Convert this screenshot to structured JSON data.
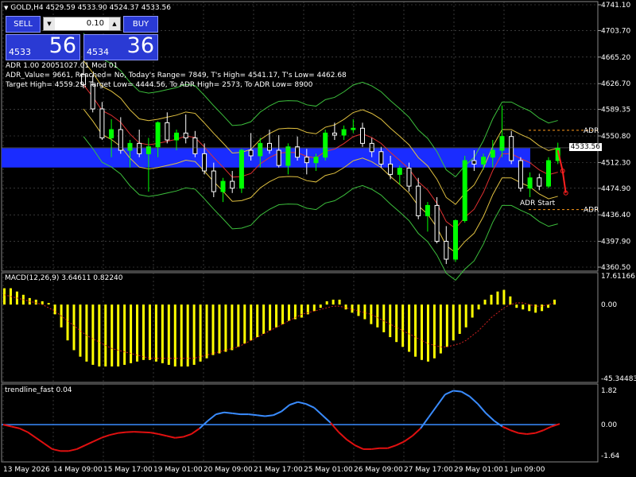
{
  "header": {
    "symbol_title": "GOLD,H4",
    "ohlc": "4529.59 4533.90 4524.37 4533.56"
  },
  "trade_panel": {
    "sell_label": "SELL",
    "buy_label": "BUY",
    "lot": "0.10",
    "sell_small": "4533",
    "sell_big": "56",
    "buy_small": "4534",
    "buy_big": "36",
    "lot_down_icon": "triangle-down",
    "lot_up_icon": "triangle-up"
  },
  "adr_info": {
    "line1": "ADR 1.00 20051027.01 Mod 01",
    "line2": "ADR_Value= 9661, Reached= No, Today's Range= 7849, T's High= 4541.17, T's Low= 4462.68",
    "line3": "Target High= 4559.29, Target Low= 4444.56, To ADR High= 2573, To ADR Low= 8900"
  },
  "price_scale": {
    "ticks": [
      "4741.10",
      "4703.70",
      "4665.20",
      "4626.70",
      "4589.35",
      "4550.80",
      "4512.30",
      "4474.90",
      "4436.40",
      "4397.90",
      "4360.50"
    ],
    "current_price": "4533.56"
  },
  "markers": {
    "adr_high": "ADR",
    "adr_low": "ADR",
    "adr_start": "ADR Start"
  },
  "macd": {
    "label": "MACD(12,26,9) 3.64611 0.82240",
    "scale_top": "17.61166",
    "scale_zero": "0.00",
    "scale_bottom": "-45.34483"
  },
  "trendline": {
    "label": "trendline_fast 0.04",
    "scale_top": "1.82",
    "scale_zero": "0.00",
    "scale_bottom": "-1.64"
  },
  "time_axis": {
    "labels": [
      "13 May 2026",
      "14 May 09:00",
      "15 May 17:00",
      "19 May 01:00",
      "20 May 09:00",
      "21 May 17:00",
      "25 May 01:00",
      "26 May 09:00",
      "27 May 17:00",
      "29 May 01:00",
      "1 Jun 09:00"
    ]
  },
  "colors": {
    "background": "#000000",
    "bull": "#00ff00",
    "bear": "#ffffff",
    "blue_band": "#1a2cff",
    "macd_hist": "#ffff00",
    "macd_signal": "#d02020",
    "trend_up": "#3a8cff",
    "trend_down": "#e01010",
    "adr_label": "#ff9a1a",
    "bollinger_outer": "#3cbf3c",
    "bollinger_inner": "#e0c040",
    "ma": "#e03030"
  },
  "chart_data": {
    "type": "candlestick",
    "price_range": [
      4360.5,
      4741.1
    ],
    "candles": [
      {
        "o": 4640,
        "h": 4660,
        "l": 4620,
        "c": 4625
      },
      {
        "o": 4625,
        "h": 4640,
        "l": 4585,
        "c": 4590
      },
      {
        "o": 4590,
        "h": 4600,
        "l": 4545,
        "c": 4548
      },
      {
        "o": 4548,
        "h": 4575,
        "l": 4520,
        "c": 4560
      },
      {
        "o": 4560,
        "h": 4578,
        "l": 4525,
        "c": 4530
      },
      {
        "o": 4530,
        "h": 4545,
        "l": 4505,
        "c": 4540
      },
      {
        "o": 4540,
        "h": 4560,
        "l": 4520,
        "c": 4525
      },
      {
        "o": 4525,
        "h": 4548,
        "l": 4470,
        "c": 4535
      },
      {
        "o": 4535,
        "h": 4572,
        "l": 4520,
        "c": 4570
      },
      {
        "o": 4570,
        "h": 4585,
        "l": 4540,
        "c": 4545
      },
      {
        "o": 4545,
        "h": 4560,
        "l": 4530,
        "c": 4555
      },
      {
        "o": 4555,
        "h": 4582,
        "l": 4540,
        "c": 4548
      },
      {
        "o": 4548,
        "h": 4558,
        "l": 4520,
        "c": 4525
      },
      {
        "o": 4525,
        "h": 4540,
        "l": 4495,
        "c": 4500
      },
      {
        "o": 4500,
        "h": 4512,
        "l": 4462,
        "c": 4470
      },
      {
        "o": 4470,
        "h": 4490,
        "l": 4455,
        "c": 4485
      },
      {
        "o": 4485,
        "h": 4500,
        "l": 4468,
        "c": 4475
      },
      {
        "o": 4475,
        "h": 4532,
        "l": 4468,
        "c": 4530
      },
      {
        "o": 4530,
        "h": 4555,
        "l": 4515,
        "c": 4522
      },
      {
        "o": 4522,
        "h": 4548,
        "l": 4505,
        "c": 4540
      },
      {
        "o": 4540,
        "h": 4560,
        "l": 4525,
        "c": 4530
      },
      {
        "o": 4530,
        "h": 4552,
        "l": 4505,
        "c": 4508
      },
      {
        "o": 4508,
        "h": 4540,
        "l": 4495,
        "c": 4535
      },
      {
        "o": 4535,
        "h": 4550,
        "l": 4515,
        "c": 4520
      },
      {
        "o": 4520,
        "h": 4532,
        "l": 4495,
        "c": 4512
      },
      {
        "o": 4512,
        "h": 4525,
        "l": 4500,
        "c": 4520
      },
      {
        "o": 4520,
        "h": 4560,
        "l": 4515,
        "c": 4555
      },
      {
        "o": 4555,
        "h": 4570,
        "l": 4545,
        "c": 4552
      },
      {
        "o": 4552,
        "h": 4566,
        "l": 4545,
        "c": 4560
      },
      {
        "o": 4560,
        "h": 4575,
        "l": 4555,
        "c": 4562
      },
      {
        "o": 4562,
        "h": 4570,
        "l": 4535,
        "c": 4540
      },
      {
        "o": 4540,
        "h": 4548,
        "l": 4520,
        "c": 4528
      },
      {
        "o": 4528,
        "h": 4535,
        "l": 4505,
        "c": 4510
      },
      {
        "o": 4510,
        "h": 4522,
        "l": 4488,
        "c": 4495
      },
      {
        "o": 4495,
        "h": 4508,
        "l": 4480,
        "c": 4504
      },
      {
        "o": 4504,
        "h": 4512,
        "l": 4470,
        "c": 4478
      },
      {
        "o": 4478,
        "h": 4490,
        "l": 4430,
        "c": 4435
      },
      {
        "o": 4435,
        "h": 4455,
        "l": 4412,
        "c": 4450
      },
      {
        "o": 4450,
        "h": 4462,
        "l": 4395,
        "c": 4398
      },
      {
        "o": 4398,
        "h": 4420,
        "l": 4365,
        "c": 4372
      },
      {
        "o": 4372,
        "h": 4430,
        "l": 4368,
        "c": 4428
      },
      {
        "o": 4428,
        "h": 4522,
        "l": 4425,
        "c": 4515
      },
      {
        "o": 4515,
        "h": 4530,
        "l": 4500,
        "c": 4510
      },
      {
        "o": 4510,
        "h": 4525,
        "l": 4502,
        "c": 4520
      },
      {
        "o": 4520,
        "h": 4545,
        "l": 4505,
        "c": 4530
      },
      {
        "o": 4530,
        "h": 4595,
        "l": 4520,
        "c": 4550
      },
      {
        "o": 4550,
        "h": 4558,
        "l": 4510,
        "c": 4515
      },
      {
        "o": 4515,
        "h": 4520,
        "l": 4470,
        "c": 4475
      },
      {
        "o": 4475,
        "h": 4498,
        "l": 4462,
        "c": 4490
      },
      {
        "o": 4490,
        "h": 4496,
        "l": 4472,
        "c": 4478
      },
      {
        "o": 4478,
        "h": 4520,
        "l": 4475,
        "c": 4515
      },
      {
        "o": 4515,
        "h": 4541,
        "l": 4510,
        "c": 4533
      }
    ],
    "macd_histogram": [
      10,
      10,
      8,
      6,
      4,
      3,
      2,
      1,
      -6,
      -14,
      -22,
      -28,
      -32,
      -35,
      -37,
      -38,
      -38,
      -38,
      -38,
      -37,
      -36,
      -35,
      -34,
      -34,
      -35,
      -36,
      -37,
      -38,
      -38,
      -38,
      -37,
      -35,
      -33,
      -31,
      -30,
      -29,
      -28,
      -26,
      -24,
      -22,
      -20,
      -18,
      -16,
      -14,
      -12,
      -10,
      -9,
      -8,
      -6,
      -4,
      -2,
      2,
      3,
      3,
      -3,
      -5,
      -7,
      -9,
      -12,
      -14,
      -17,
      -20,
      -23,
      -26,
      -29,
      -32,
      -34,
      -35,
      -33,
      -30,
      -26,
      -22,
      -18,
      -14,
      -8,
      -3,
      3,
      6,
      8,
      9,
      5,
      -2,
      -3,
      -4,
      -5,
      -4,
      -2,
      3
    ],
    "macd_signal": [
      6,
      5,
      4,
      3,
      2,
      1,
      0,
      -2,
      -4,
      -7,
      -10,
      -13,
      -16,
      -19,
      -21,
      -23,
      -25,
      -27,
      -28,
      -29,
      -30,
      -31,
      -32,
      -33,
      -33,
      -33,
      -33,
      -33,
      -33,
      -33,
      -33,
      -32,
      -31,
      -30,
      -29,
      -28,
      -27,
      -26,
      -24,
      -22,
      -20,
      -18,
      -16,
      -14,
      -12,
      -10,
      -8,
      -6,
      -5,
      -4,
      -3,
      -2,
      -1,
      -1,
      -2,
      -3,
      -4,
      -5,
      -6,
      -8,
      -10,
      -12,
      -14,
      -16,
      -18,
      -20,
      -22,
      -24,
      -25,
      -26,
      -26,
      -25,
      -24,
      -22,
      -19,
      -16,
      -12,
      -8,
      -5,
      -2,
      0,
      1,
      1,
      0,
      -1,
      -1,
      0,
      1
    ],
    "trendline": [
      0,
      -0.1,
      -0.2,
      -0.4,
      -0.7,
      -1.0,
      -1.3,
      -1.4,
      -1.4,
      -1.3,
      -1.1,
      -0.9,
      -0.7,
      -0.55,
      -0.45,
      -0.4,
      -0.38,
      -0.4,
      -0.42,
      -0.5,
      -0.6,
      -0.7,
      -0.65,
      -0.5,
      -0.2,
      0.2,
      0.55,
      0.65,
      0.6,
      0.55,
      0.55,
      0.5,
      0.45,
      0.5,
      0.7,
      1.05,
      1.2,
      1.1,
      0.9,
      0.5,
      0.1,
      -0.4,
      -0.8,
      -1.1,
      -1.3,
      -1.3,
      -1.25,
      -1.25,
      -1.1,
      -0.9,
      -0.6,
      -0.2,
      0.4,
      1.0,
      1.6,
      1.8,
      1.75,
      1.5,
      1.1,
      0.6,
      0.2,
      -0.1,
      -0.3,
      -0.45,
      -0.5,
      -0.45,
      -0.3,
      -0.1,
      0.04
    ]
  }
}
